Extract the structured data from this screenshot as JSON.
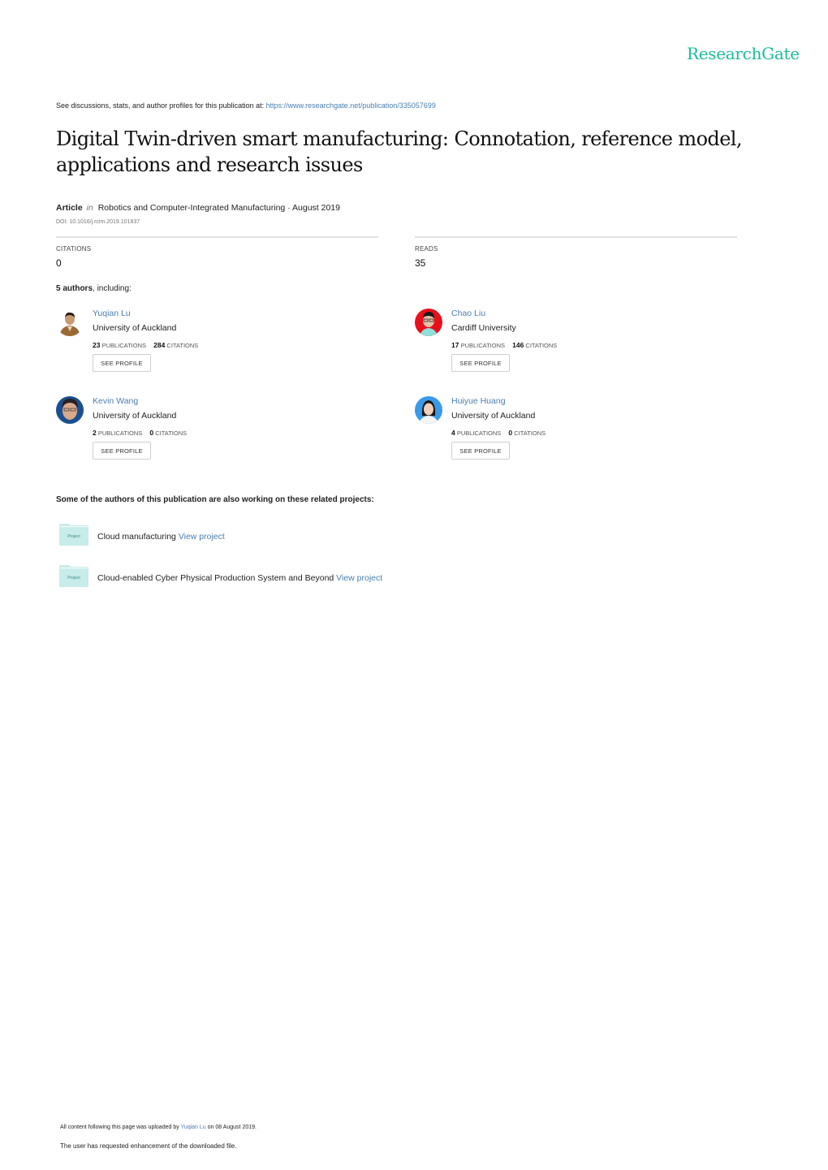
{
  "brand": {
    "name": "ResearchGate",
    "color": "#1bbc9b"
  },
  "header": {
    "see_text": "See discussions, stats, and author profiles for this publication at: ",
    "publication_url": "https://www.researchgate.net/publication/335057699"
  },
  "publication": {
    "title": "Digital Twin-driven smart manufacturing: Connotation, reference model, applications and research issues",
    "type": "Article",
    "in_label": "in",
    "journal_date": "Robotics and Computer-Integrated Manufacturing · August 2019",
    "doi": "DOI: 10.1016/j.rcim.2019.101837"
  },
  "stats": {
    "citations_label": "CITATIONS",
    "citations_value": "0",
    "reads_label": "READS",
    "reads_value": "35"
  },
  "authors_heading": {
    "count": "5 authors",
    "suffix": ", including:"
  },
  "authors": [
    {
      "name": "Yuqian Lu",
      "institution": "University of Auckland",
      "publications": "23",
      "publications_label": "PUBLICATIONS",
      "citations": "284",
      "citations_label": "CITATIONS",
      "button": "SEE PROFILE"
    },
    {
      "name": "Chao Liu",
      "institution": "Cardiff University",
      "publications": "17",
      "publications_label": "PUBLICATIONS",
      "citations": "146",
      "citations_label": "CITATIONS",
      "button": "SEE PROFILE"
    },
    {
      "name": "Kevin Wang",
      "institution": "University of Auckland",
      "publications": "2",
      "publications_label": "PUBLICATIONS",
      "citations": "0",
      "citations_label": "CITATIONS",
      "button": "SEE PROFILE"
    },
    {
      "name": "Huiyue Huang",
      "institution": "University of Auckland",
      "publications": "4",
      "publications_label": "PUBLICATIONS",
      "citations": "0",
      "citations_label": "CITATIONS",
      "button": "SEE PROFILE"
    }
  ],
  "projects_heading": "Some of the authors of this publication are also working on these related projects:",
  "projects": [
    {
      "icon_label": "Project",
      "name": "Cloud manufacturing ",
      "link": "View project"
    },
    {
      "icon_label": "Project",
      "name": "Cloud-enabled Cyber Physical Production System and Beyond ",
      "link": "View project"
    }
  ],
  "footer": {
    "uploaded_prefix": "All content following this page was uploaded by ",
    "uploader": "Yuqian Lu",
    "uploaded_suffix": " on 08 August 2019.",
    "note": "The user has requested enhancement of the downloaded file."
  }
}
